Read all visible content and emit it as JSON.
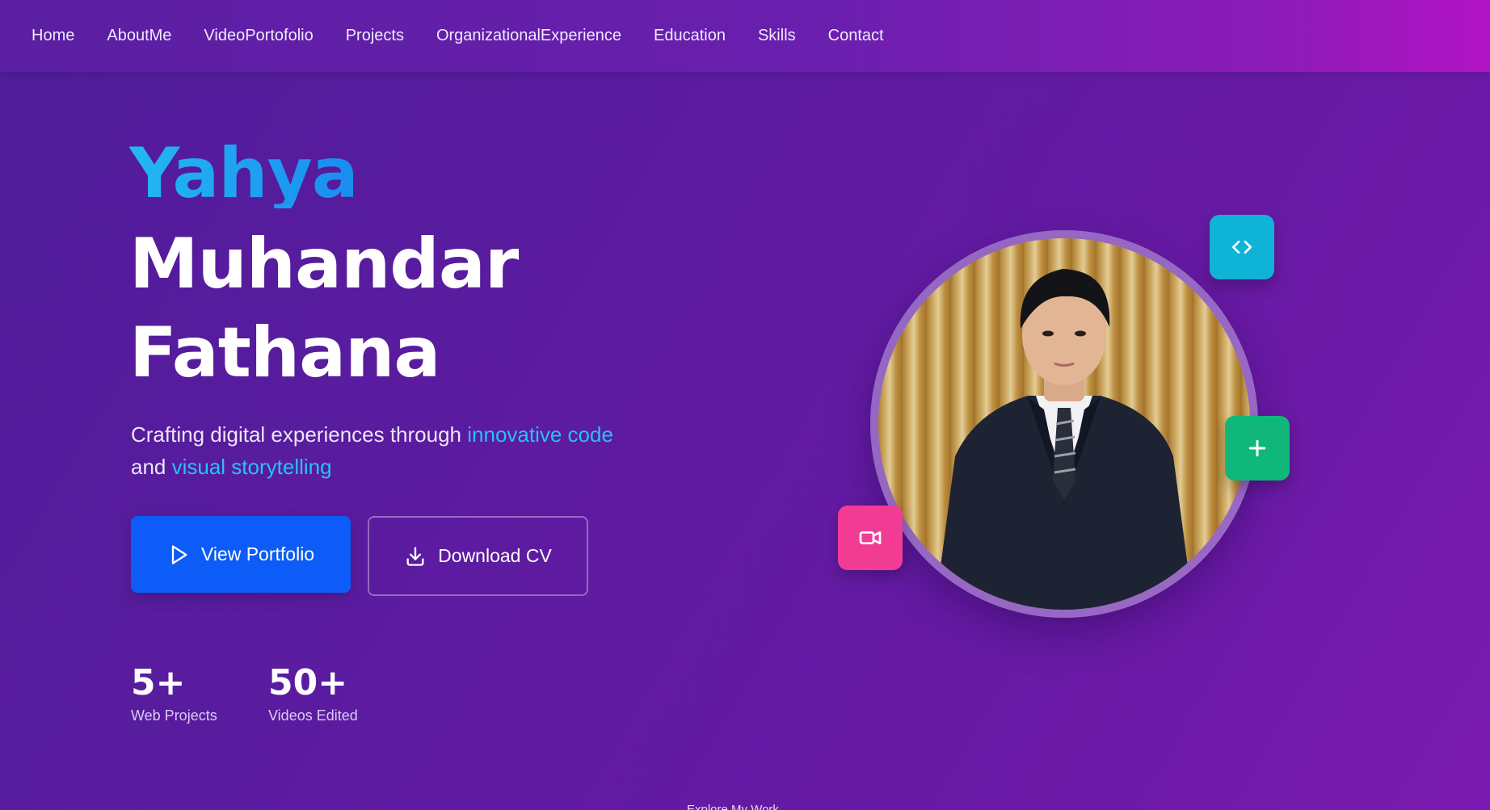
{
  "nav": {
    "items": [
      {
        "label": "Home"
      },
      {
        "label": "AboutMe"
      },
      {
        "label": "VideoPortofolio"
      },
      {
        "label": "Projects"
      },
      {
        "label": "OrganizationalExperience"
      },
      {
        "label": "Education"
      },
      {
        "label": "Skills"
      },
      {
        "label": "Contact"
      }
    ]
  },
  "hero": {
    "name_first": "Yahya",
    "name_middle": "Muhandar",
    "name_last": "Fathana",
    "tagline_part1": "Crafting digital experiences through ",
    "tagline_accent1": "innovative code",
    "tagline_part2": "and ",
    "tagline_accent2": "visual storytelling",
    "buttons": {
      "primary_label": "View Portfolio",
      "primary_icon": "play-icon",
      "secondary_label": "Download CV",
      "secondary_icon": "download-icon"
    },
    "stats": [
      {
        "value": "5+",
        "label": "Web Projects"
      },
      {
        "value": "50+",
        "label": "Videos Edited"
      }
    ]
  },
  "profile": {
    "badges": [
      {
        "icon": "code-icon",
        "color": "#0fb3d8"
      },
      {
        "icon": "plus-icon",
        "color": "#10b77a"
      },
      {
        "icon": "video-camera-icon",
        "color": "#f23b93"
      }
    ]
  },
  "footer_hint": "Explore My Work",
  "colors": {
    "accent": "#27c1f5",
    "primary_button": "#0d5cf7"
  }
}
